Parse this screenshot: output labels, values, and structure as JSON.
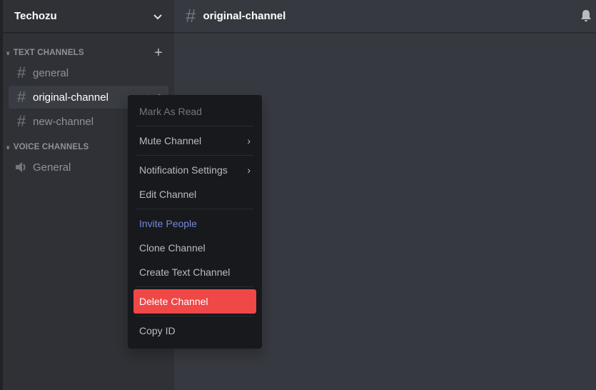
{
  "server": {
    "name": "Techozu"
  },
  "sidebar": {
    "categories": [
      {
        "label": "TEXT CHANNELS"
      },
      {
        "label": "VOICE CHANNELS"
      }
    ],
    "text_channels": [
      {
        "name": "general"
      },
      {
        "name": "original-channel"
      },
      {
        "name": "new-channel"
      }
    ],
    "voice_channels": [
      {
        "name": "General"
      }
    ]
  },
  "header": {
    "channel": "original-channel"
  },
  "context_menu": {
    "items": [
      {
        "label": "Mark As Read"
      },
      {
        "label": "Mute Channel"
      },
      {
        "label": "Notification Settings"
      },
      {
        "label": "Edit Channel"
      },
      {
        "label": "Invite People"
      },
      {
        "label": "Clone Channel"
      },
      {
        "label": "Create Text Channel"
      },
      {
        "label": "Delete Channel"
      },
      {
        "label": "Copy ID"
      }
    ]
  },
  "colors": {
    "danger": "#f04747",
    "brand": "#7289da"
  }
}
